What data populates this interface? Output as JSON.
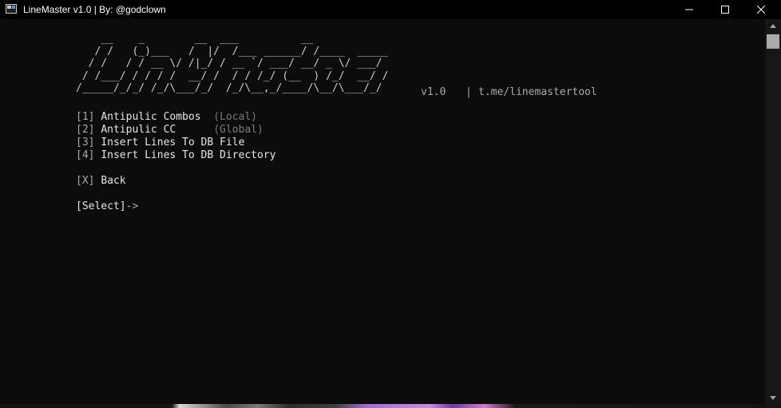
{
  "window": {
    "title": "LineMaster v1.0 | By: @godclown"
  },
  "banner": {
    "ascii_art": "    __    _        __  ___          __\n   / /   (_)___   /  |/  /___ ______/ /____  _____\n  / /   / / __ \\/ /|_/ / __ `/ ___/ __/ _ \\/ ___/\n / /___/ / / / /  __/ /  / / /_/ (__  ) /_/  __/ /\n/_____/_/_/ /_/\\___/_/  /_/\\__,_/____/\\__/\\___/_/",
    "version": "v1.0",
    "separator": "|",
    "link": "t.me/linemastertool"
  },
  "menu": {
    "items": [
      {
        "key": "[1]",
        "label": "Antipulic Combos",
        "scope": "(Local)"
      },
      {
        "key": "[2]",
        "label": "Antipulic CC",
        "scope": "(Global)"
      },
      {
        "key": "[3]",
        "label": "Insert Lines To DB File",
        "scope": ""
      },
      {
        "key": "[4]",
        "label": "Insert Lines To DB Directory",
        "scope": ""
      }
    ],
    "back": {
      "key": "[X]",
      "label": "Back"
    },
    "prompt": {
      "label": "[Select]",
      "arrow": "->"
    }
  },
  "colors": {
    "background": "#0c0c0c",
    "text": "#cccccc",
    "muted": "#7a7a7a",
    "titlebar": "#000000"
  },
  "icons": {
    "app": "console-app-icon",
    "minimize": "minimize-icon",
    "maximize": "maximize-icon",
    "close": "close-icon"
  }
}
